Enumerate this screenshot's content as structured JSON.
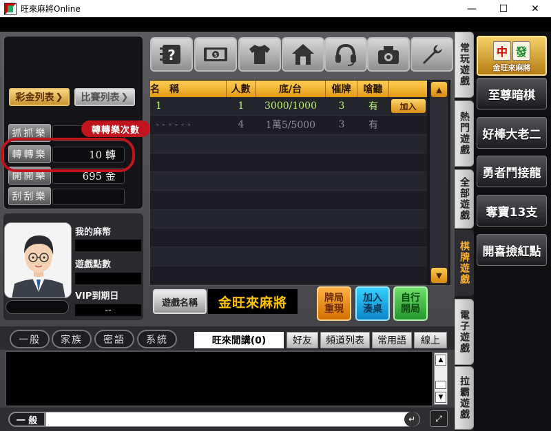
{
  "window": {
    "title": "旺來麻將Online",
    "minimize": "—",
    "maximize": "☐",
    "close": "✕"
  },
  "left_tabs": {
    "prize_list": "彩金列表",
    "match_list": "比賽列表"
  },
  "prize_rows": [
    {
      "label": "抓抓樂",
      "value": ""
    },
    {
      "label": "轉轉樂",
      "value": "10 轉"
    },
    {
      "label": "開開樂",
      "value": "695 金"
    },
    {
      "label": "刮刮樂",
      "value": ""
    }
  ],
  "callout": "轉轉樂次數",
  "profile": {
    "mahjong_coins_label": "我的麻幣",
    "mahjong_coins_value": "",
    "game_points_label": "遊戲點數",
    "game_points_value": "",
    "vip_label": "VIP到期日",
    "vip_value": "--"
  },
  "toolbar": [
    "help",
    "cash",
    "shirt",
    "home",
    "headset",
    "camera",
    "wrench"
  ],
  "table": {
    "headers": [
      "名　稱",
      "人數",
      "底/台",
      "催牌",
      "嗆聽"
    ],
    "rows": [
      {
        "name": "1",
        "players": "1",
        "stake": "3000/1000",
        "urge": "3",
        "call": "有",
        "action": "加入",
        "state": "active"
      },
      {
        "name": "- - - - - -",
        "players": "4",
        "stake": "1萬5/5000",
        "urge": "3",
        "call": "有",
        "action": "",
        "state": "muted"
      }
    ]
  },
  "game_name": {
    "button": "遊戲名稱",
    "value": "金旺來麻將"
  },
  "actions": {
    "replay": "牌局\n重現",
    "join_table": "加入\n湊桌",
    "open_table": "自行\n開局"
  },
  "chat_tabs": [
    "一般",
    "家族",
    "密語",
    "系統"
  ],
  "channel": {
    "title": "旺來閒講(0)",
    "buttons": [
      "好友",
      "頻道列表",
      "常用語",
      "線上"
    ]
  },
  "chat_input": {
    "channel": "一 般",
    "placeholder": ""
  },
  "categories": [
    "常玩遊戲",
    "熱門遊戲",
    "全部遊戲",
    "棋牌遊戲",
    "電子遊戲",
    "拉霸遊戲"
  ],
  "featured_game": {
    "tiles": [
      "中",
      "發"
    ],
    "caption": "金旺來麻將"
  },
  "games": [
    "至尊暗棋",
    "好棒大老二",
    "勇者鬥接龍",
    "奪寶13支",
    "開喜撿紅點"
  ]
}
